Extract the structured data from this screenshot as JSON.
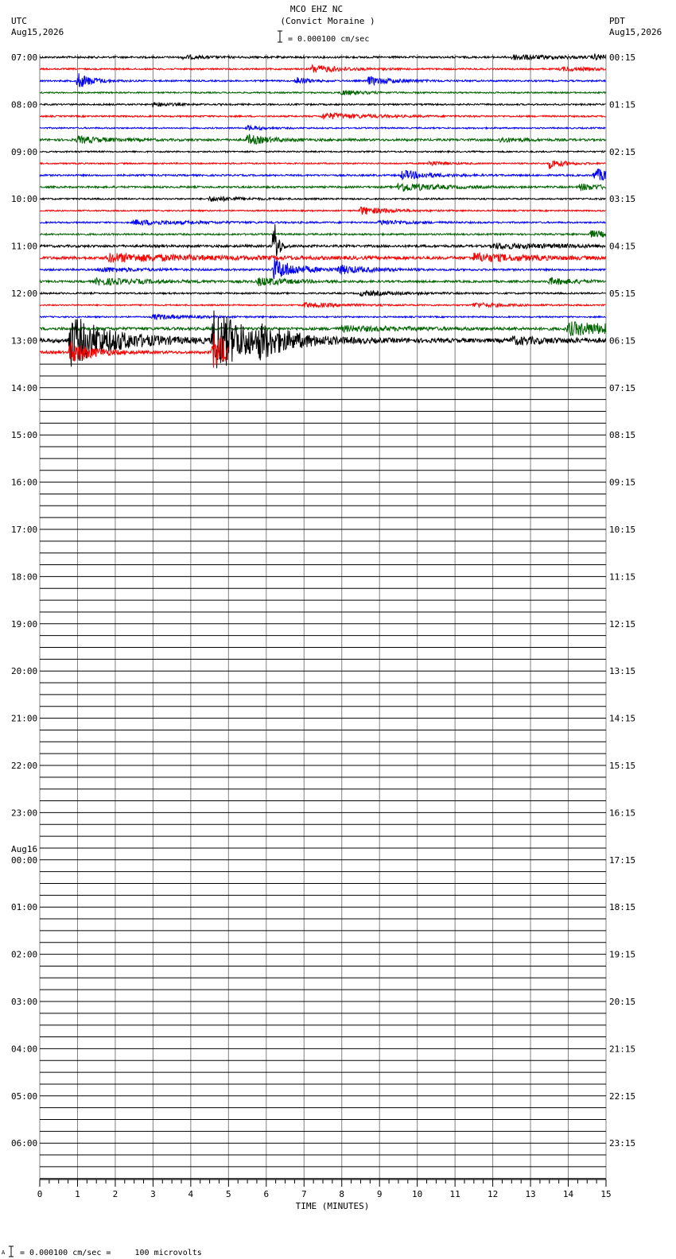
{
  "header": {
    "station": "MCO EHZ NC",
    "site": "(Convict Moraine )",
    "scale_text": "= 0.000100 cm/sec",
    "left_zone": "UTC",
    "left_date": "Aug15,2026",
    "right_zone": "PDT",
    "right_date": "Aug15,2026"
  },
  "footer": {
    "marker": "A",
    "scale_text": "= 0.000100 cm/sec =     100 microvolts"
  },
  "colors": {
    "trace_cycle": [
      "#000000",
      "#ff0000",
      "#0000ff",
      "#006400"
    ],
    "grid": "#808080",
    "empty_line": "#000000"
  },
  "chart_data": {
    "type": "line",
    "subtype": "helicorder",
    "xlabel": "TIME (MINUTES)",
    "xlim": [
      0,
      15
    ],
    "x_ticks": [
      "0",
      "1",
      "2",
      "3",
      "4",
      "5",
      "6",
      "7",
      "8",
      "9",
      "10",
      "11",
      "12",
      "13",
      "14",
      "15"
    ],
    "lines_per_hour": 4,
    "minutes_per_line": 15,
    "total_lines": 96,
    "left_hour_labels": [
      "07:00",
      "08:00",
      "09:00",
      "10:00",
      "11:00",
      "12:00",
      "13:00",
      "14:00",
      "15:00",
      "16:00",
      "17:00",
      "18:00",
      "19:00",
      "20:00",
      "21:00",
      "22:00",
      "23:00",
      "00:00",
      "01:00",
      "02:00",
      "03:00",
      "04:00",
      "05:00",
      "06:00"
    ],
    "left_date_change": {
      "hour_index": 17,
      "label": "Aug16"
    },
    "right_hour_labels": [
      "00:15",
      "01:15",
      "02:15",
      "03:15",
      "04:15",
      "05:15",
      "06:15",
      "07:15",
      "08:15",
      "09:15",
      "10:15",
      "11:15",
      "12:15",
      "13:15",
      "14:15",
      "15:15",
      "16:15",
      "17:15",
      "18:15",
      "19:15",
      "20:15",
      "21:15",
      "22:15",
      "23:15"
    ],
    "recorded_lines": 26,
    "last_line_end_minute": 5.0,
    "trace_noise": [
      1.2,
      1.0,
      1.0,
      0.9,
      1.0,
      1.0,
      0.9,
      1.4,
      0.9,
      0.9,
      1.1,
      1.2,
      1.0,
      0.9,
      1.0,
      1.1,
      1.5,
      1.8,
      1.2,
      1.3,
      1.0,
      0.9,
      0.9,
      1.8,
      2.6,
      1.6
    ],
    "events": [
      {
        "line": 0,
        "minute": 3.8,
        "amp": 2,
        "dur": 0.6
      },
      {
        "line": 0,
        "minute": 12.5,
        "amp": 3,
        "dur": 1.2
      },
      {
        "line": 0,
        "minute": 14.7,
        "amp": 3,
        "dur": 0.5
      },
      {
        "line": 1,
        "minute": 7.2,
        "amp": 5,
        "dur": 0.8
      },
      {
        "line": 1,
        "minute": 13.8,
        "amp": 2,
        "dur": 1.5
      },
      {
        "line": 2,
        "minute": 1.0,
        "amp": 10,
        "dur": 0.4
      },
      {
        "line": 2,
        "minute": 6.8,
        "amp": 5,
        "dur": 0.3
      },
      {
        "line": 2,
        "minute": 8.7,
        "amp": 5,
        "dur": 0.7
      },
      {
        "line": 3,
        "minute": 8.0,
        "amp": 3,
        "dur": 0.6
      },
      {
        "line": 4,
        "minute": 3.0,
        "amp": 3,
        "dur": 0.4
      },
      {
        "line": 5,
        "minute": 7.5,
        "amp": 4,
        "dur": 1.2
      },
      {
        "line": 6,
        "minute": 5.5,
        "amp": 3,
        "dur": 0.4
      },
      {
        "line": 7,
        "minute": 1.0,
        "amp": 4,
        "dur": 0.8
      },
      {
        "line": 7,
        "minute": 5.5,
        "amp": 6,
        "dur": 0.6
      },
      {
        "line": 7,
        "minute": 12.2,
        "amp": 3,
        "dur": 0.5
      },
      {
        "line": 9,
        "minute": 10.3,
        "amp": 3,
        "dur": 0.4
      },
      {
        "line": 9,
        "minute": 13.5,
        "amp": 6,
        "dur": 0.4
      },
      {
        "line": 10,
        "minute": 9.6,
        "amp": 6,
        "dur": 0.7
      },
      {
        "line": 10,
        "minute": 14.7,
        "amp": 8,
        "dur": 0.7
      },
      {
        "line": 11,
        "minute": 9.5,
        "amp": 6,
        "dur": 0.9
      },
      {
        "line": 11,
        "minute": 14.3,
        "amp": 4,
        "dur": 0.7
      },
      {
        "line": 12,
        "minute": 4.5,
        "amp": 3,
        "dur": 0.8
      },
      {
        "line": 13,
        "minute": 8.5,
        "amp": 5,
        "dur": 0.7
      },
      {
        "line": 14,
        "minute": 2.5,
        "amp": 3,
        "dur": 1.5
      },
      {
        "line": 14,
        "minute": 9.0,
        "amp": 3,
        "dur": 0.8
      },
      {
        "line": 15,
        "minute": 14.6,
        "amp": 4,
        "dur": 0.8
      },
      {
        "line": 16,
        "minute": 12.0,
        "amp": 3,
        "dur": 2.0
      },
      {
        "line": 16,
        "minute": 6.2,
        "amp": 40,
        "dur": 0.1
      },
      {
        "line": 17,
        "minute": 1.8,
        "amp": 5,
        "dur": 2.5
      },
      {
        "line": 17,
        "minute": 11.5,
        "amp": 5,
        "dur": 1.5
      },
      {
        "line": 18,
        "minute": 6.2,
        "amp": 14,
        "dur": 0.6
      },
      {
        "line": 18,
        "minute": 7.9,
        "amp": 5,
        "dur": 0.8
      },
      {
        "line": 18,
        "minute": 1.6,
        "amp": 3,
        "dur": 1.0
      },
      {
        "line": 19,
        "minute": 5.8,
        "amp": 5,
        "dur": 0.8
      },
      {
        "line": 19,
        "minute": 1.5,
        "amp": 4,
        "dur": 1.5
      },
      {
        "line": 19,
        "minute": 13.5,
        "amp": 4,
        "dur": 0.8
      },
      {
        "line": 20,
        "minute": 8.5,
        "amp": 3,
        "dur": 1.0
      },
      {
        "line": 21,
        "minute": 7.0,
        "amp": 3,
        "dur": 1.0
      },
      {
        "line": 21,
        "minute": 11.5,
        "amp": 3,
        "dur": 0.8
      },
      {
        "line": 22,
        "minute": 3.0,
        "amp": 3,
        "dur": 1.0
      },
      {
        "line": 23,
        "minute": 14.0,
        "amp": 8,
        "dur": 2.0
      },
      {
        "line": 23,
        "minute": 8.0,
        "amp": 3,
        "dur": 1.5
      },
      {
        "line": 24,
        "minute": 0.8,
        "amp": 32,
        "dur": 1.1
      },
      {
        "line": 24,
        "minute": 4.6,
        "amp": 40,
        "dur": 1.0
      },
      {
        "line": 24,
        "minute": 5.8,
        "amp": 12,
        "dur": 0.8
      },
      {
        "line": 24,
        "minute": 12.5,
        "amp": 4,
        "dur": 1.0
      },
      {
        "line": 25,
        "minute": 0.8,
        "amp": 14,
        "dur": 0.6
      },
      {
        "line": 25,
        "minute": 4.6,
        "amp": 24,
        "dur": 0.6
      }
    ]
  }
}
